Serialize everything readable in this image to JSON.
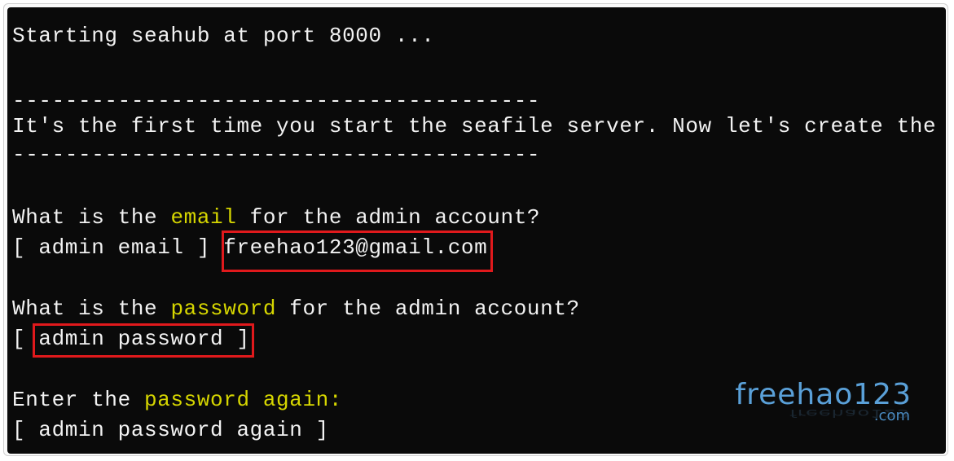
{
  "terminal": {
    "line_start": "Starting seahub at port 8000 ...",
    "divider": "----------------------------------------",
    "line_first_time": "It's the first time you start the seafile server. Now let's create the",
    "email_q_pre": "What is the ",
    "email_q_hl": "email",
    "email_q_post": " for the admin account?",
    "email_prompt": "[ admin email ] ",
    "email_value": "freehao123@gmail.com",
    "password_q_pre": "What is the ",
    "password_q_hl": "password",
    "password_q_post": " for the admin account?",
    "password_prompt_open": "[ ",
    "password_prompt_label": "admin password ]",
    "again_pre": "Enter the ",
    "again_hl": "password again:",
    "again_prompt": "[ admin password again ]"
  },
  "watermark": {
    "name": "freehao123",
    "tld": ".com"
  },
  "colors": {
    "background": "#0a0a0a",
    "text": "#f2f2f2",
    "highlight": "#d6d600",
    "annotation_box": "#e0191c"
  }
}
